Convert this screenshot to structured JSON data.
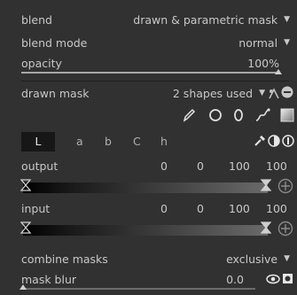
{
  "blend": {
    "label": "blend",
    "value": "drawn & parametric mask"
  },
  "blend_mode": {
    "label": "blend mode",
    "value": "normal"
  },
  "opacity": {
    "label": "opacity",
    "value": "100%",
    "level_percent": 100
  },
  "drawn_mask": {
    "label": "drawn mask",
    "value": "2 shapes used"
  },
  "channels": {
    "tabs": [
      "L",
      "a",
      "b",
      "C",
      "h"
    ],
    "selected": "L"
  },
  "output": {
    "label": "output",
    "values": [
      "0",
      "0",
      "100",
      "100"
    ]
  },
  "input": {
    "label": "input",
    "values": [
      "0",
      "0",
      "100",
      "100"
    ]
  },
  "combine_masks": {
    "label": "combine masks",
    "value": "exclusive"
  },
  "mask_blur": {
    "label": "mask blur",
    "value": "0.0",
    "level_percent": 0
  },
  "colors": {
    "background": "#313131",
    "text": "#c8c8c8"
  }
}
